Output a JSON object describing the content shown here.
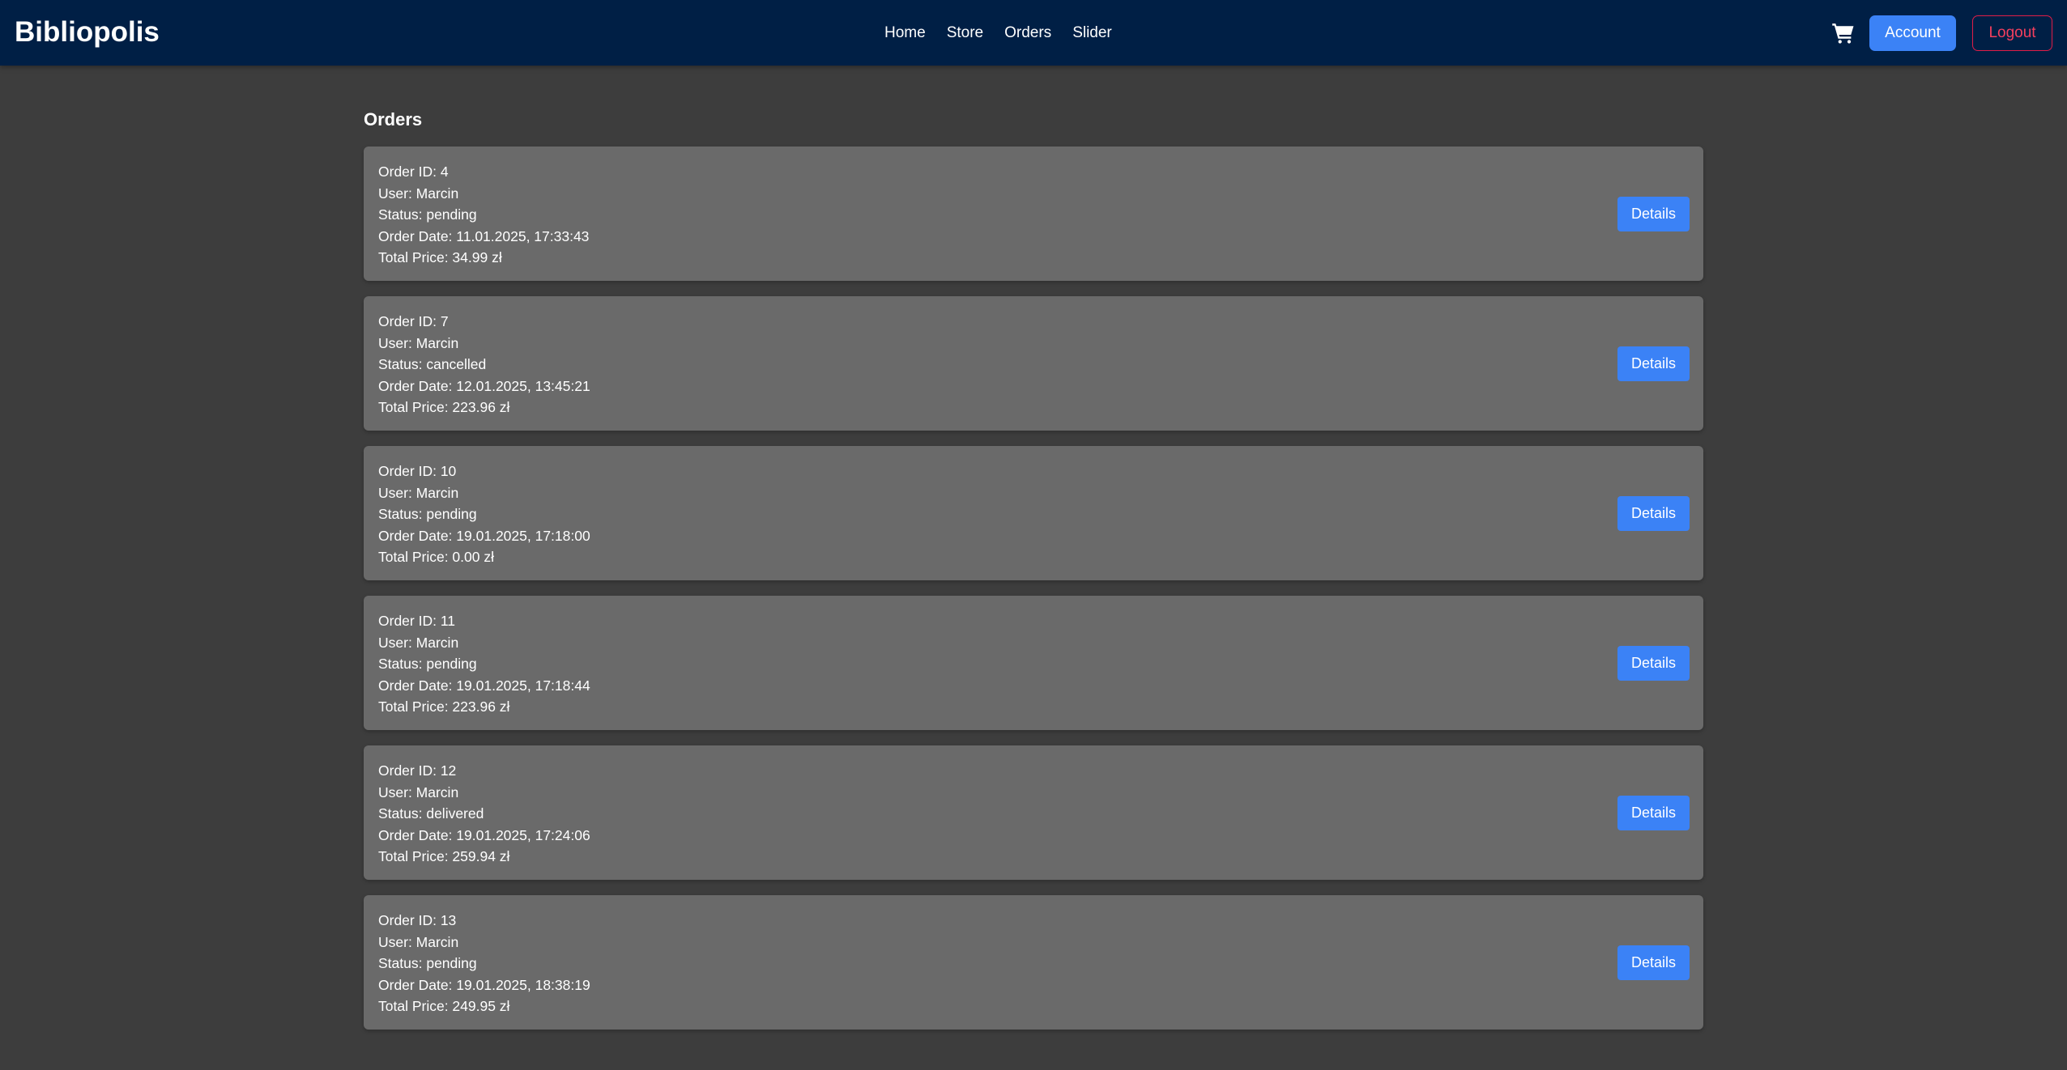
{
  "header": {
    "brand": "Bibliopolis",
    "nav": [
      "Home",
      "Store",
      "Orders",
      "Slider"
    ],
    "cart_icon": "shopping-cart-icon",
    "account_label": "Account",
    "logout_label": "Logout"
  },
  "page": {
    "title": "Orders"
  },
  "orders": [
    {
      "id_line": "Order ID: 4",
      "user_line": "User: Marcin",
      "status_line": "Status: pending",
      "date_line": "Order Date: 11.01.2025, 17:33:43",
      "price_line": "Total Price: 34.99 zł",
      "details_label": "Details"
    },
    {
      "id_line": "Order ID: 7",
      "user_line": "User: Marcin",
      "status_line": "Status: cancelled",
      "date_line": "Order Date: 12.01.2025, 13:45:21",
      "price_line": "Total Price: 223.96 zł",
      "details_label": "Details"
    },
    {
      "id_line": "Order ID: 10",
      "user_line": "User: Marcin",
      "status_line": "Status: pending",
      "date_line": "Order Date: 19.01.2025, 17:18:00",
      "price_line": "Total Price: 0.00 zł",
      "details_label": "Details"
    },
    {
      "id_line": "Order ID: 11",
      "user_line": "User: Marcin",
      "status_line": "Status: pending",
      "date_line": "Order Date: 19.01.2025, 17:18:44",
      "price_line": "Total Price: 223.96 zł",
      "details_label": "Details"
    },
    {
      "id_line": "Order ID: 12",
      "user_line": "User: Marcin",
      "status_line": "Status: delivered",
      "date_line": "Order Date: 19.01.2025, 17:24:06",
      "price_line": "Total Price: 259.94 zł",
      "details_label": "Details"
    },
    {
      "id_line": "Order ID: 13",
      "user_line": "User: Marcin",
      "status_line": "Status: pending",
      "date_line": "Order Date: 19.01.2025, 18:38:19",
      "price_line": "Total Price: 249.95 zł",
      "details_label": "Details"
    }
  ],
  "colors": {
    "navbar": "#001f45",
    "page_background": "#3d3d3d",
    "card_background": "#6a6a6a",
    "primary": "#3b82f6",
    "danger": "#e11d48"
  }
}
